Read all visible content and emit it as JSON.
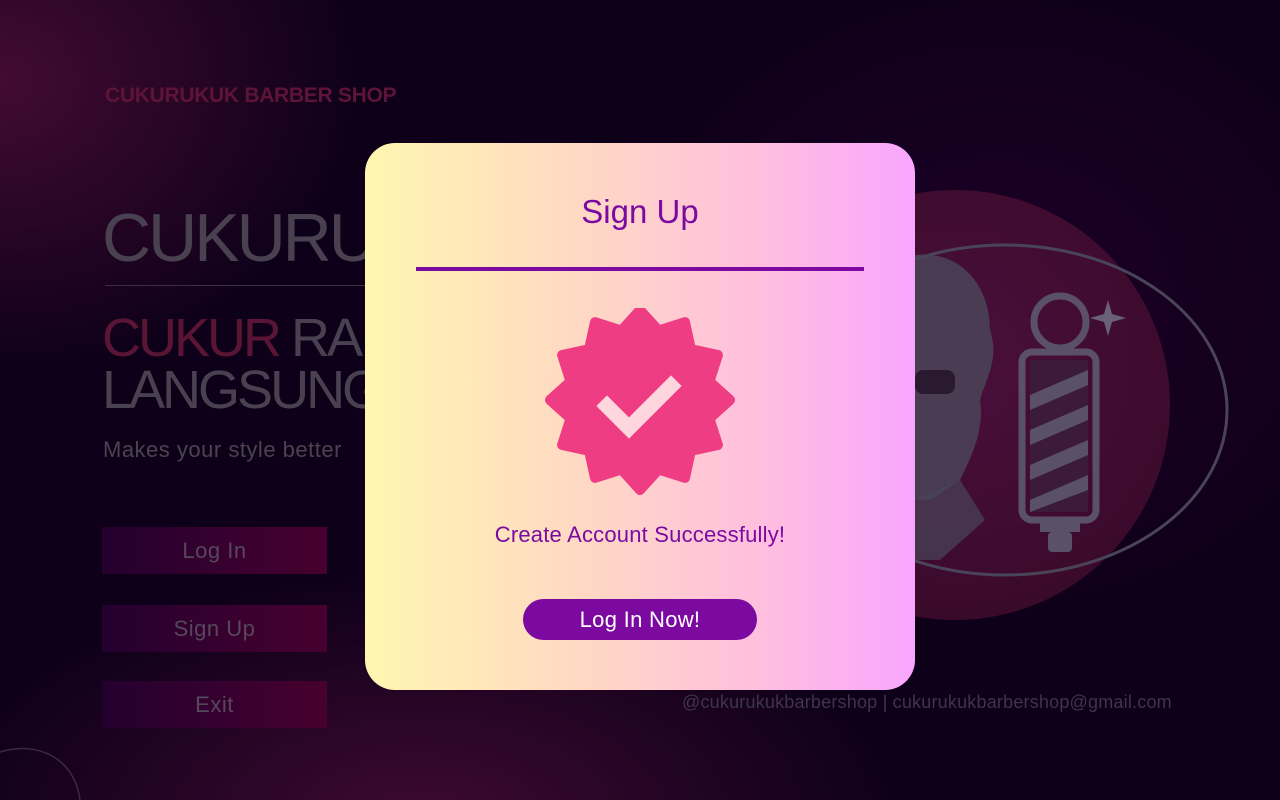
{
  "background": {
    "brand": "CUKURUKUK BARBER SHOP",
    "hero_title": "CUKURUKUK",
    "hero_sub_accent": "CUKUR",
    "hero_sub_rest": " RA",
    "hero_sub_line2": "LANGSUNG",
    "tagline": "Makes your style better",
    "buttons": {
      "login": "Log In",
      "signup": "Sign Up",
      "exit": "Exit"
    },
    "contact": "@cukurukukbarbershop | cukurukukbarbershop@gmail.com"
  },
  "modal": {
    "title": "Sign Up",
    "message": "Create Account Successfully!",
    "cta_label": "Log In Now!",
    "icon": "verified-badge-icon"
  },
  "colors": {
    "accent_purple": "#7c0aa0",
    "badge_pink": "#ef3d84",
    "background": "#0d0018"
  }
}
